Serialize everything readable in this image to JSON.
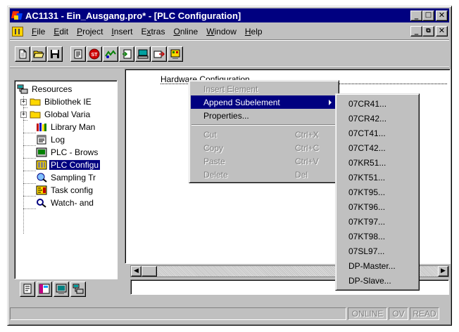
{
  "window": {
    "title": "AC1131 - Ein_Ausgang.pro* - [PLC Configuration]"
  },
  "menubar": {
    "items": [
      {
        "pre": "",
        "u": "F",
        "post": "ile"
      },
      {
        "pre": "",
        "u": "E",
        "post": "dit"
      },
      {
        "pre": "",
        "u": "P",
        "post": "roject"
      },
      {
        "pre": "",
        "u": "I",
        "post": "nsert"
      },
      {
        "pre": "E",
        "u": "x",
        "post": "tras"
      },
      {
        "pre": "",
        "u": "O",
        "post": "nline"
      },
      {
        "pre": "",
        "u": "W",
        "post": "indow"
      },
      {
        "pre": "",
        "u": "H",
        "post": "elp"
      }
    ]
  },
  "toolbar": {
    "icons": [
      "new-file-icon",
      "open-folder-icon",
      "save-disk-icon",
      "build-icon",
      "stop-icon",
      "login-icon",
      "download-icon",
      "monitor-icon",
      "export-icon",
      "configuration-icon"
    ]
  },
  "tree": {
    "root": "Resources",
    "items": [
      {
        "label": "Bibliothek IE",
        "icon": "folder-icon",
        "expandable": true
      },
      {
        "label": "Global Varia",
        "icon": "folder-icon",
        "expandable": true
      },
      {
        "label": "Library Man",
        "icon": "library-icon",
        "expandable": false
      },
      {
        "label": "Log",
        "icon": "log-icon",
        "expandable": false
      },
      {
        "label": "PLC - Brows",
        "icon": "plc-browser-icon",
        "expandable": false
      },
      {
        "label": "PLC Configu",
        "icon": "plc-config-icon",
        "expandable": false,
        "selected": true
      },
      {
        "label": "Sampling Tr",
        "icon": "sampling-trace-icon",
        "expandable": false
      },
      {
        "label": "Task config",
        "icon": "task-config-icon",
        "expandable": false
      },
      {
        "label": "Watch- and",
        "icon": "watch-icon",
        "expandable": false
      }
    ]
  },
  "config": {
    "title": "Hardware Configuration"
  },
  "context_menu": {
    "items": [
      {
        "label": "Insert Element",
        "shortcut": "",
        "disabled": true
      },
      {
        "label": "Append Subelement",
        "shortcut": "",
        "disabled": false,
        "highlighted": true,
        "submenu": true
      },
      {
        "label": "Properties...",
        "shortcut": "",
        "disabled": false
      },
      {
        "label": "Cut",
        "shortcut": "Ctrl+X",
        "disabled": true
      },
      {
        "label": "Copy",
        "shortcut": "Ctrl+C",
        "disabled": true
      },
      {
        "label": "Paste",
        "shortcut": "Ctrl+V",
        "disabled": true
      },
      {
        "label": "Delete",
        "shortcut": "Del",
        "disabled": true
      }
    ]
  },
  "submenu": {
    "items": [
      "07CR41...",
      "07CR42...",
      "07CT41...",
      "07CT42...",
      "07KR51...",
      "07KT51...",
      "07KT95...",
      "07KT96...",
      "07KT97...",
      "07KT98...",
      "07SL97...",
      "DP-Master...",
      "DP-Slave..."
    ]
  },
  "statusbar": {
    "online": "ONLINE",
    "ov": "OV",
    "read": "READ"
  }
}
